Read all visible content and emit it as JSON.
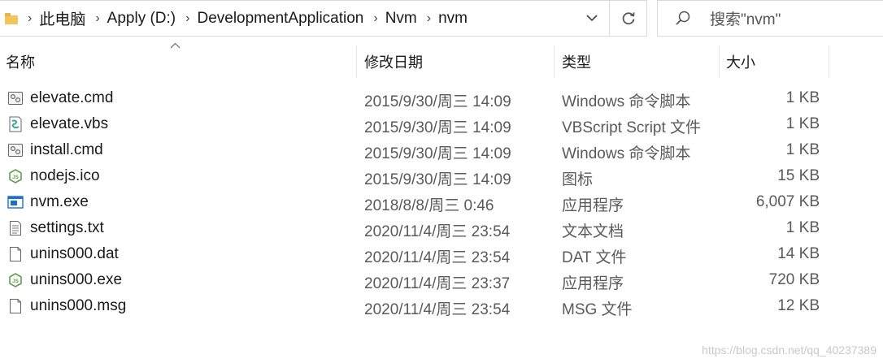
{
  "address_bar": {
    "crumbs": [
      "此电脑",
      "Apply (D:)",
      "DevelopmentApplication",
      "Nvm",
      "nvm"
    ]
  },
  "search": {
    "placeholder": "搜索\"nvm\""
  },
  "columns": {
    "name": "名称",
    "date": "修改日期",
    "type": "类型",
    "size": "大小"
  },
  "files": [
    {
      "name": "elevate.cmd",
      "date": "2015/9/30/周三 14:09",
      "type": "Windows 命令脚本",
      "size": "1 KB",
      "icon": "cmd-script-icon"
    },
    {
      "name": "elevate.vbs",
      "date": "2015/9/30/周三 14:09",
      "type": "VBScript Script 文件",
      "size": "1 KB",
      "icon": "vbs-script-icon"
    },
    {
      "name": "install.cmd",
      "date": "2015/9/30/周三 14:09",
      "type": "Windows 命令脚本",
      "size": "1 KB",
      "icon": "cmd-script-icon"
    },
    {
      "name": "nodejs.ico",
      "date": "2015/9/30/周三 14:09",
      "type": "图标",
      "size": "15 KB",
      "icon": "nodejs-icon"
    },
    {
      "name": "nvm.exe",
      "date": "2018/8/8/周三 0:46",
      "type": "应用程序",
      "size": "6,007 KB",
      "icon": "exe-app-icon"
    },
    {
      "name": "settings.txt",
      "date": "2020/11/4/周三 23:54",
      "type": "文本文档",
      "size": "1 KB",
      "icon": "text-file-icon"
    },
    {
      "name": "unins000.dat",
      "date": "2020/11/4/周三 23:54",
      "type": "DAT 文件",
      "size": "14 KB",
      "icon": "blank-file-icon"
    },
    {
      "name": "unins000.exe",
      "date": "2020/11/4/周三 23:37",
      "type": "应用程序",
      "size": "720 KB",
      "icon": "nodejs-icon"
    },
    {
      "name": "unins000.msg",
      "date": "2020/11/4/周三 23:54",
      "type": "MSG 文件",
      "size": "12 KB",
      "icon": "blank-file-icon"
    }
  ],
  "watermark": "https://blog.csdn.net/qq_40237389"
}
